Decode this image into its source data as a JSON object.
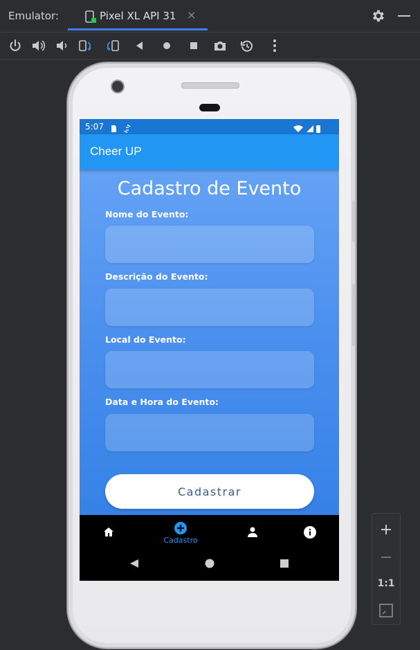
{
  "emulator": {
    "label": "Emulator:",
    "tab_label": "Pixel XL API 31",
    "tab_close": "×",
    "zoom": {
      "in": "+",
      "out": "−",
      "one_to_one": "1:1"
    },
    "accent_color": "#3d7ff0"
  },
  "device": {
    "status_time": "5:07",
    "app_title": "Cheer UP",
    "form": {
      "title": "Cadastro de Evento",
      "fields": [
        {
          "label": "Nome do Evento:",
          "value": ""
        },
        {
          "label": "Descrição do Evento:",
          "value": ""
        },
        {
          "label": "Local do Evento:",
          "value": ""
        },
        {
          "label": "Data e Hora do Evento:",
          "value": ""
        }
      ],
      "submit_label": "Cadastrar"
    },
    "bottom_nav": {
      "items": [
        {
          "icon": "home-icon",
          "label": ""
        },
        {
          "icon": "add-circle-icon",
          "label": "Cadastro",
          "active": true
        },
        {
          "icon": "person-icon",
          "label": ""
        },
        {
          "icon": "info-icon",
          "label": ""
        }
      ],
      "active_color": "#2196f3"
    },
    "colors": {
      "status_bar": "#1976d2",
      "app_bar": "#2196f3",
      "content_top": "#64a2f5",
      "content_bottom": "#3582e6"
    }
  }
}
